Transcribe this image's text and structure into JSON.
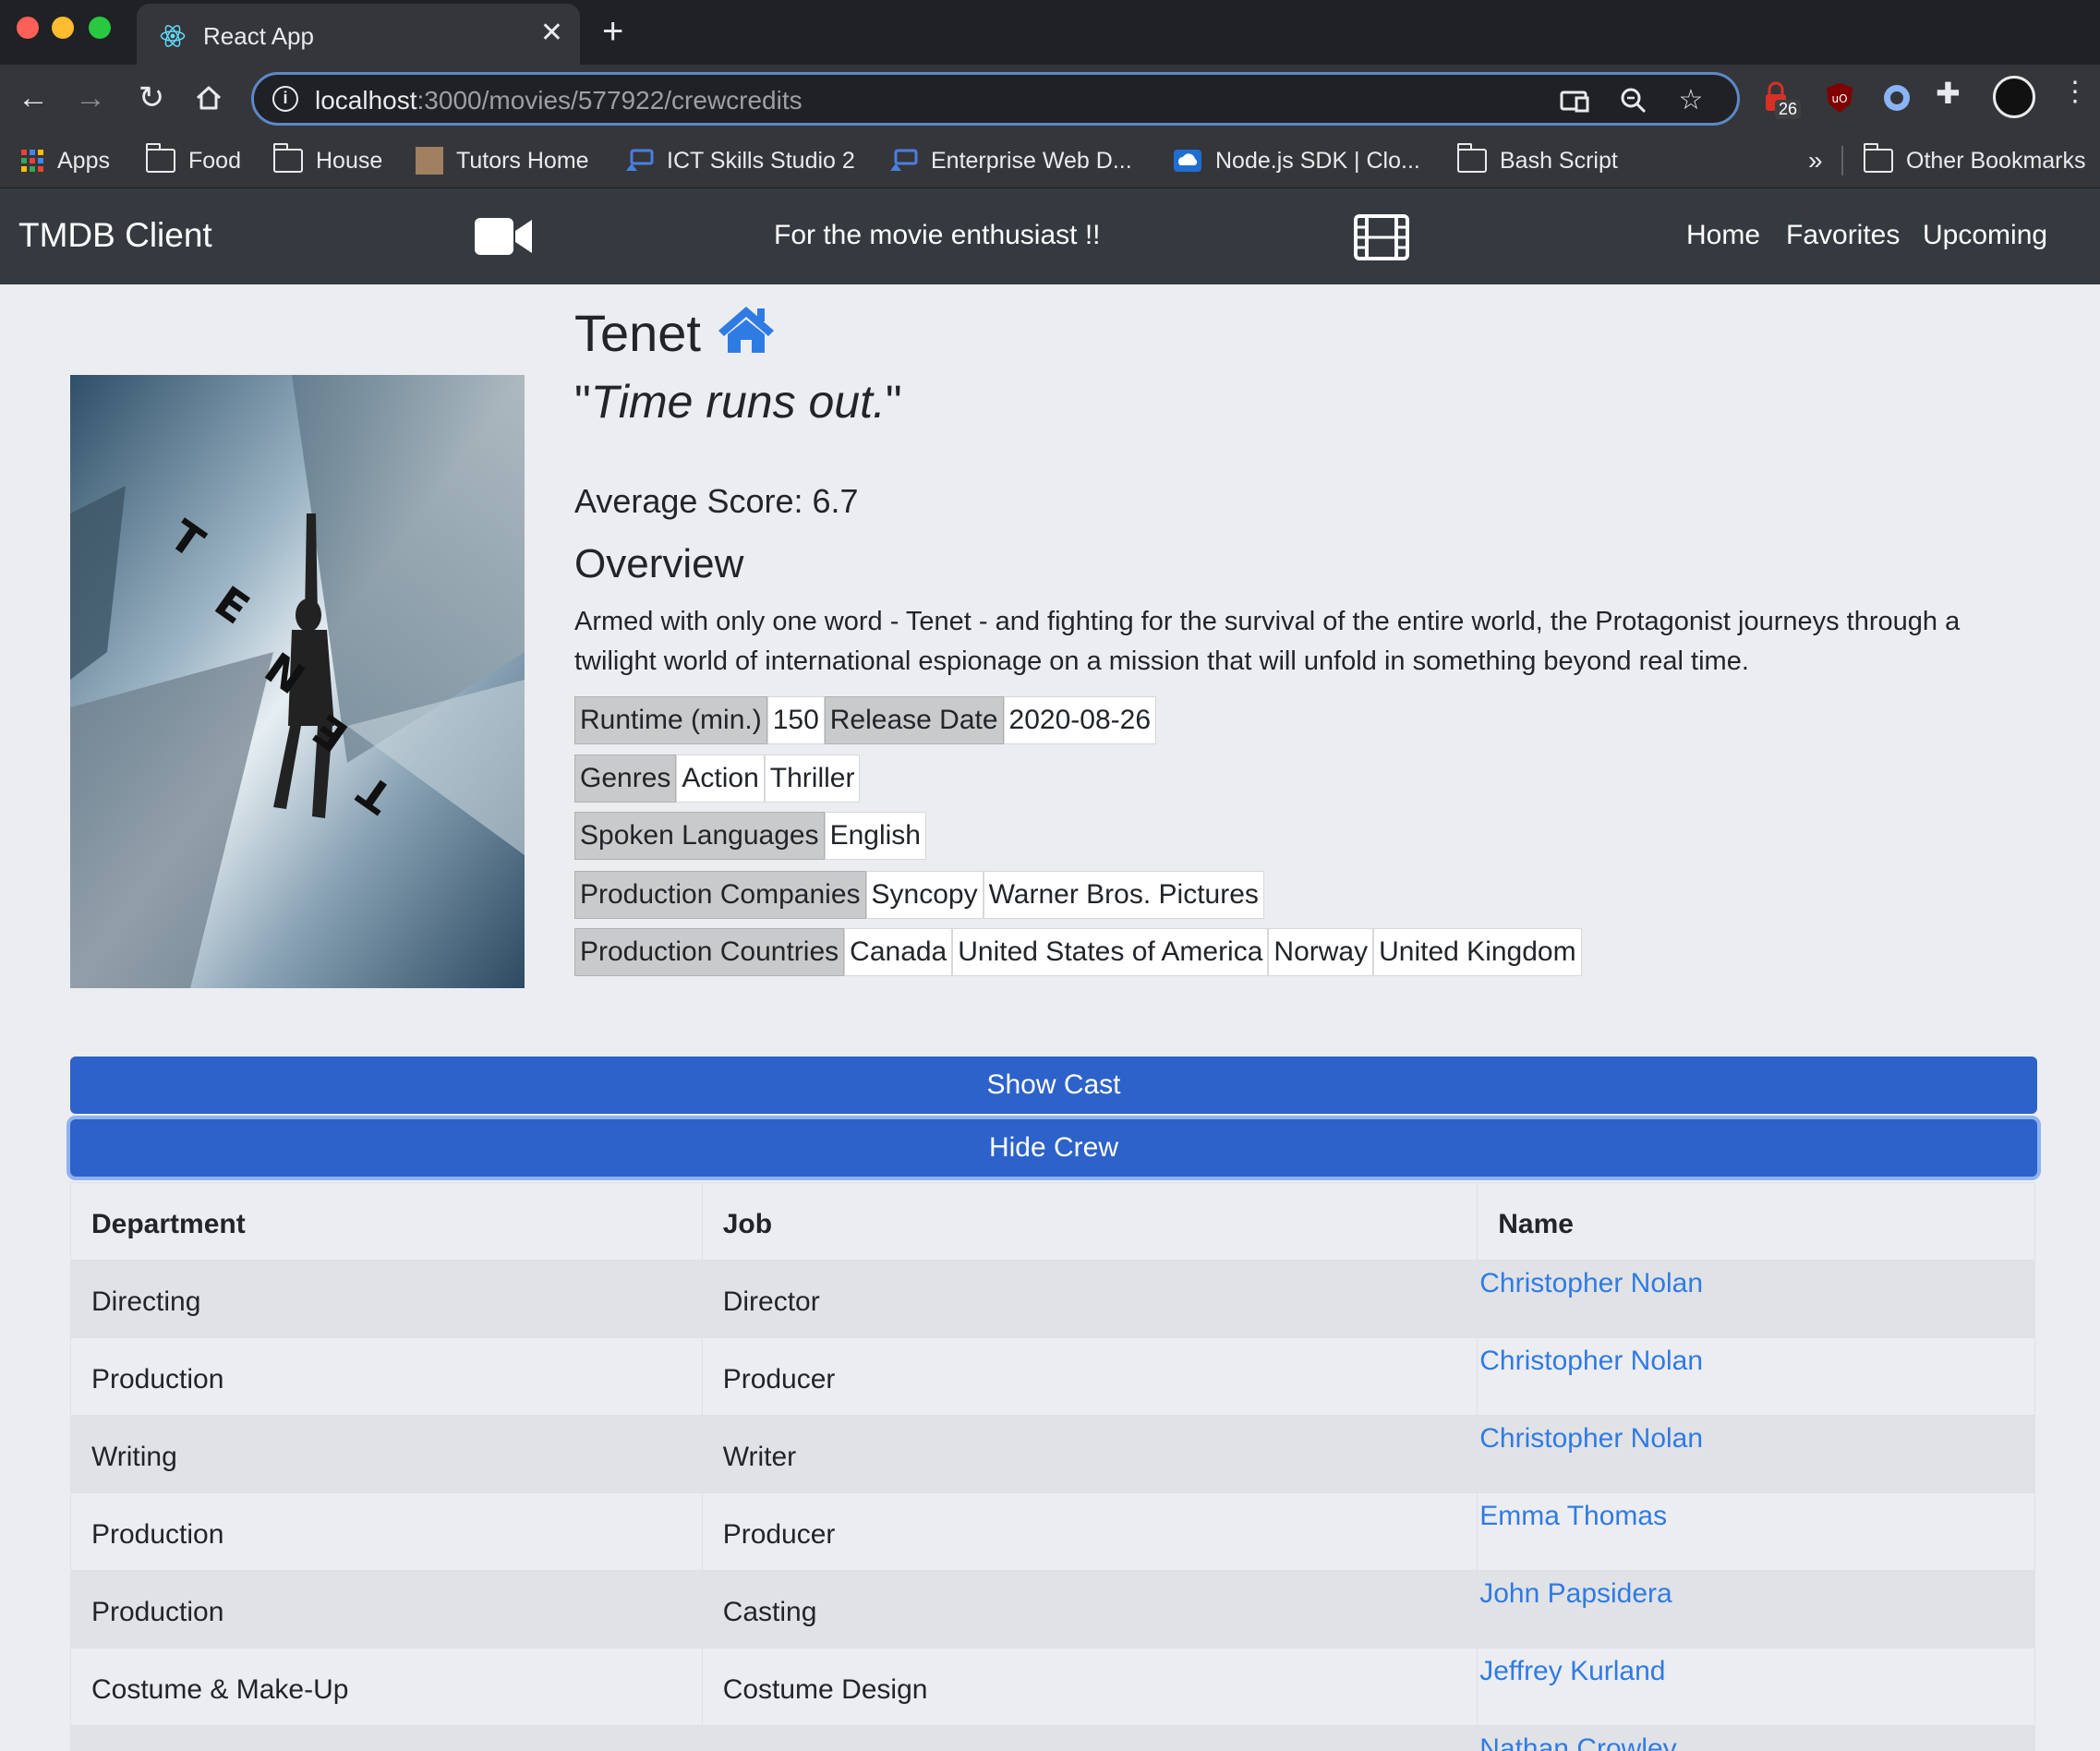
{
  "browser": {
    "tab_title": "React App",
    "url_host": "localhost",
    "url_path": ":3000/movies/577922/crewcredits",
    "extension_badge": "26",
    "bookmarks": [
      "Apps",
      "Food",
      "House",
      "Tutors Home",
      "ICT Skills Studio 2",
      "Enterprise Web D...",
      "Node.js SDK | Clo...",
      "Bash Script"
    ],
    "bookmarks_overflow": "»",
    "other_bookmarks": "Other Bookmarks"
  },
  "nav": {
    "brand": "TMDB Client",
    "tagline": "For the movie enthusiast !!",
    "links": [
      "Home",
      "Favorites",
      "Upcoming"
    ]
  },
  "movie": {
    "title": "Tenet",
    "tagline_open": "\"",
    "tagline_text": "Time runs out.",
    "tagline_close": "\"",
    "score_label": "Average Score: 6.7",
    "overview_heading": "Overview",
    "overview": "Armed with only one word - Tenet - and fighting for the survival of the entire world, the Protagonist journeys through a twilight world of international espionage on a mission that will unfold in something beyond real time.",
    "runtime_label": "Runtime (min.)",
    "runtime": "150",
    "release_label": "Release Date",
    "release_date": "2020-08-26",
    "genres_label": "Genres",
    "genres": [
      "Action",
      "Thriller"
    ],
    "languages_label": "Spoken Languages",
    "languages": [
      "English"
    ],
    "companies_label": "Production Companies",
    "companies": [
      "Syncopy",
      "Warner Bros. Pictures"
    ],
    "countries_label": "Production Countries",
    "countries": [
      "Canada",
      "United States of America",
      "Norway",
      "United Kingdom"
    ],
    "poster_title_letters": [
      "T",
      "E",
      "N",
      "E",
      "T"
    ]
  },
  "buttons": {
    "show_cast": "Show Cast",
    "hide_crew": "Hide Crew"
  },
  "crew": {
    "headers": [
      "Department",
      "Job",
      "Name"
    ],
    "rows": [
      {
        "department": "Directing",
        "job": "Director",
        "name": "Christopher Nolan"
      },
      {
        "department": "Production",
        "job": "Producer",
        "name": "Christopher Nolan"
      },
      {
        "department": "Writing",
        "job": "Writer",
        "name": "Christopher Nolan"
      },
      {
        "department": "Production",
        "job": "Producer",
        "name": "Emma Thomas"
      },
      {
        "department": "Production",
        "job": "Casting",
        "name": "John Papsidera"
      },
      {
        "department": "Costume & Make-Up",
        "job": "Costume Design",
        "name": "Jeffrey Kurland"
      },
      {
        "department": "",
        "job": "",
        "name": "Nathan Crowley"
      }
    ]
  },
  "colors": {
    "navbar": "#343a40",
    "primary_button": "#2c62c9",
    "link": "#2f7be4",
    "page_bg": "#ecedf1"
  }
}
